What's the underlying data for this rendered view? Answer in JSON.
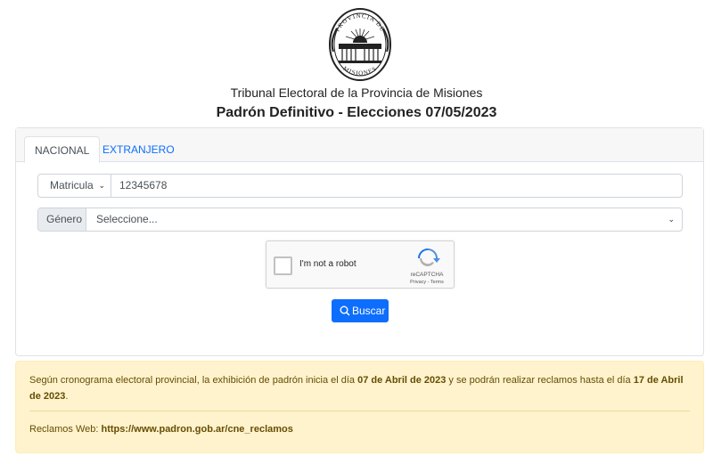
{
  "header": {
    "seal_top_text": "PROVINCIA DE",
    "seal_bottom_text": "MISIONES",
    "organization": "Tribunal Electoral de la Provincia de Misiones",
    "title": "Padrón Definitivo - Elecciones 07/05/2023"
  },
  "tabs": [
    {
      "label": "NACIONAL",
      "active": true
    },
    {
      "label": "EXTRANJERO",
      "active": false
    }
  ],
  "form": {
    "document_type": "Matricula",
    "document_number": "12345678",
    "gender_label": "Género",
    "gender_value": "Seleccione..."
  },
  "recaptcha": {
    "label": "I'm not a robot",
    "brand": "reCAPTCHA",
    "links": "Privacy - Terms"
  },
  "search_button": {
    "label": "Buscar"
  },
  "notice": {
    "part1": "Según cronograma electoral provincial, la exhibición de padrón inicia el día ",
    "date1": "07 de Abril de 2023",
    "part2": " y se podrán realizar reclamos hasta el día ",
    "date2": "17 de Abril de 2023",
    "part3": ".",
    "claims_label": "Reclamos Web: ",
    "claims_url": "https://www.padron.gob.ar/cne_reclamos"
  },
  "colors": {
    "primary": "#0d6efd",
    "alert_bg": "#fff3cd",
    "alert_text": "#664d03"
  }
}
